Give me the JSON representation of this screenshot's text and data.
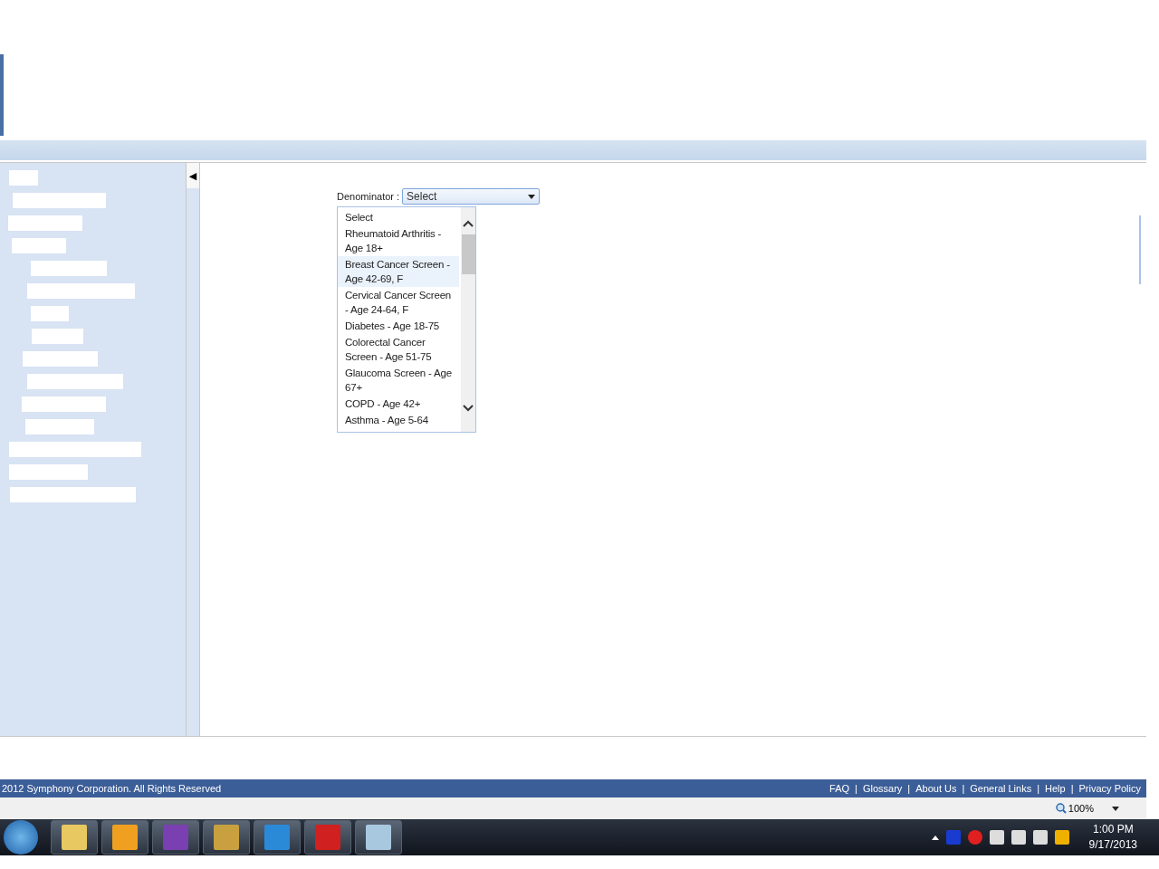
{
  "denominator": {
    "label": "Denominator :",
    "value": "Select",
    "expanded": true,
    "options": [
      {
        "label": "Select",
        "highlighted": false
      },
      {
        "label": "Rheumatoid Arthritis - Age 18+",
        "highlighted": false
      },
      {
        "label": "Breast Cancer Screen - Age 42-69, F",
        "highlighted": true
      },
      {
        "label": "Cervical Cancer Screen - Age 24-64, F",
        "highlighted": false
      },
      {
        "label": "Diabetes - Age 18-75",
        "highlighted": false
      },
      {
        "label": "Colorectal Cancer Screen - Age 51-75",
        "highlighted": false
      },
      {
        "label": "Glaucoma Screen - Age 67+",
        "highlighted": false
      },
      {
        "label": "COPD - Age 42+",
        "highlighted": false
      },
      {
        "label": "Asthma - Age 5-64",
        "highlighted": false
      }
    ]
  },
  "sidebar": {
    "collapse_button": "◀"
  },
  "footer": {
    "copyright": "2012 Symphony Corporation. All Rights Reserved",
    "separator": "|",
    "links": [
      "FAQ",
      "Glossary",
      "About Us",
      "General Links",
      "Help",
      "Privacy Policy"
    ]
  },
  "status_bar": {
    "zoom": "100%"
  },
  "taskbar": {
    "time": "1:00 PM",
    "date": "9/17/2013"
  }
}
